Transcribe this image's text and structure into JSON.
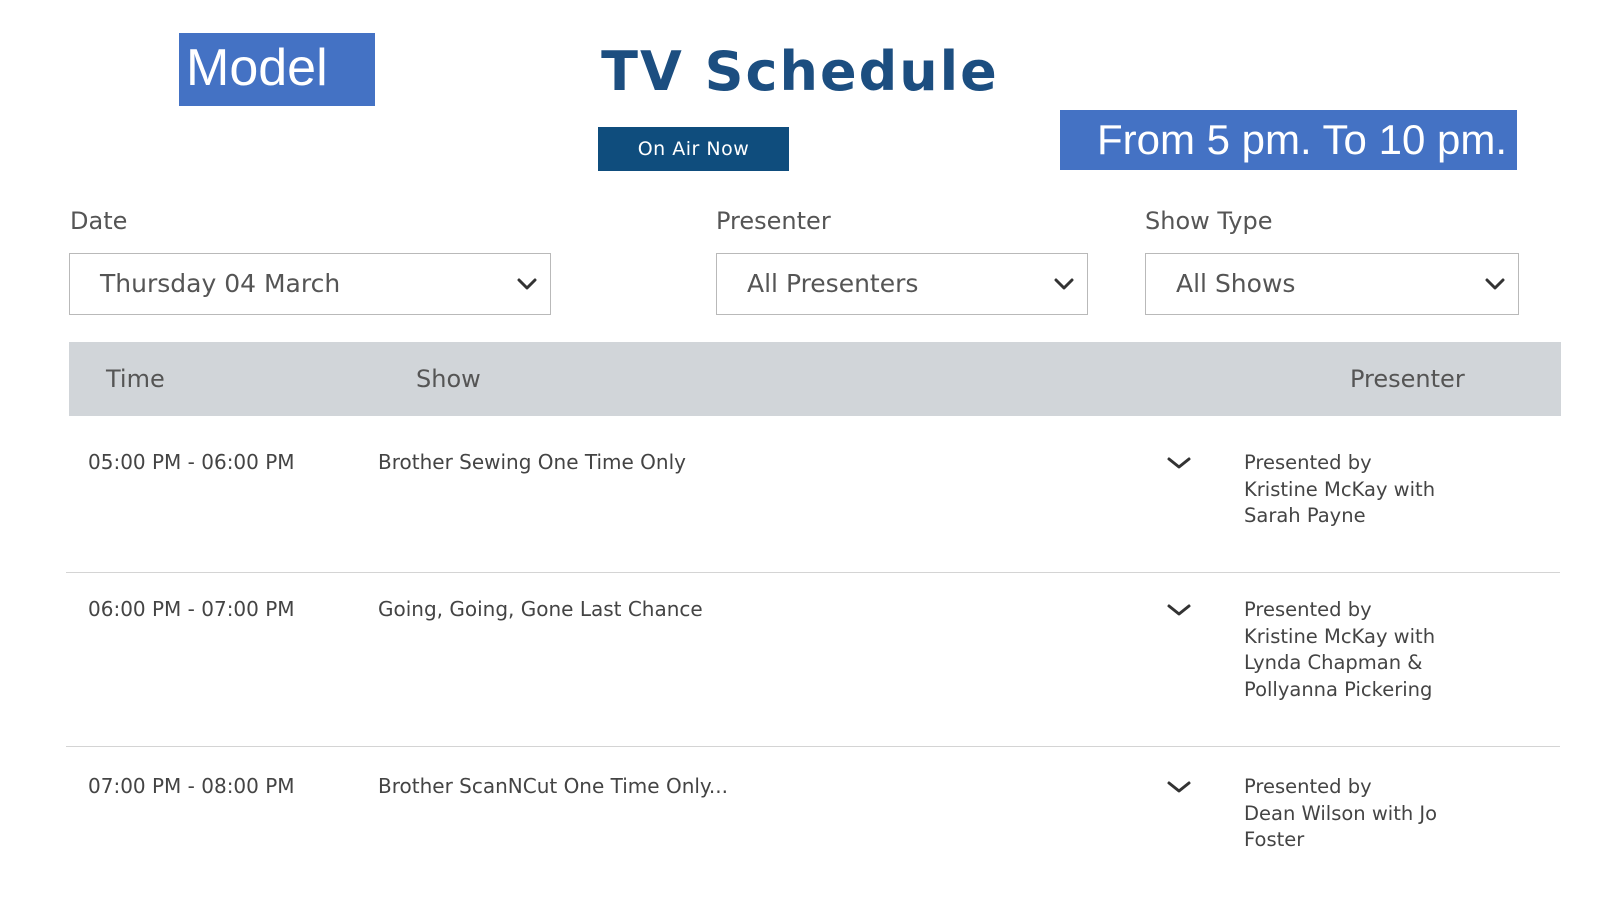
{
  "overlay": {
    "model_label": "Model",
    "range_label": "From 5 pm. To 10 pm."
  },
  "header": {
    "title": "TV Schedule",
    "on_air_label": "On Air Now"
  },
  "filters": {
    "date": {
      "label": "Date",
      "value": "Thursday 04 March"
    },
    "presenter": {
      "label": "Presenter",
      "value": "All Presenters"
    },
    "show_type": {
      "label": "Show Type",
      "value": "All Shows"
    }
  },
  "table": {
    "columns": [
      "Time",
      "Show",
      "Presenter"
    ],
    "rows": [
      {
        "time": "05:00 PM - 06:00 PM",
        "show": "Brother Sewing One Time Only",
        "presenter_lines": [
          "Presented by",
          "Kristine McKay with",
          "Sarah Payne"
        ]
      },
      {
        "time": "06:00 PM - 07:00 PM",
        "show": "Going, Going, Gone Last Chance",
        "presenter_lines": [
          "Presented by",
          "Kristine McKay with",
          "Lynda Chapman &",
          "Pollyanna Pickering"
        ]
      },
      {
        "time": "07:00 PM - 08:00 PM",
        "show": "Brother ScanNCut One Time Only...",
        "presenter_lines": [
          "Presented by",
          "Dean Wilson with Jo",
          "Foster"
        ]
      }
    ]
  },
  "icons": {
    "dropdown": "chevron-down-icon",
    "expand": "chevron-down-icon"
  },
  "colors": {
    "label_box": "#4472c4",
    "title": "#1c4e80",
    "on_air_button": "#0f4d7d",
    "table_header_bg": "#d1d5d9"
  }
}
